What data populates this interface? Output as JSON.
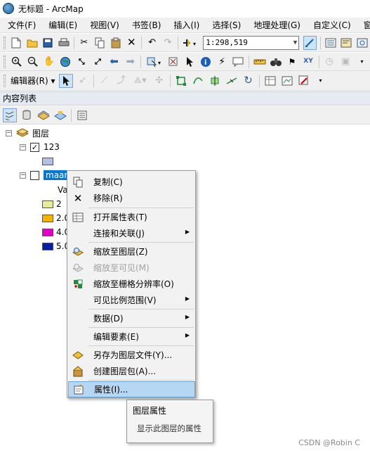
{
  "window": {
    "title": "无标题 - ArcMap"
  },
  "menubar": [
    "文件(F)",
    "编辑(E)",
    "视图(V)",
    "书签(B)",
    "插入(I)",
    "选择(S)",
    "地理处理(G)",
    "自定义(C)",
    "窗口("
  ],
  "toolbar": {
    "scale_value": "1:298,519",
    "editor_label": "编辑器(R)"
  },
  "toc": {
    "title": "内容列表",
    "root_label": "图层",
    "layer1_name": "123",
    "layer2_name_visible": "maan",
    "value_header": "Va",
    "legend": [
      {
        "label": "2",
        "color": "#e8ec9a"
      },
      {
        "label": "2.0",
        "color": "#f2b400"
      },
      {
        "label": "4.0",
        "color": "#e000c8"
      },
      {
        "label": "5.0",
        "color": "#0a1ea0"
      }
    ]
  },
  "context_menu": {
    "items": [
      {
        "label": "复制(C)",
        "icon": "copy-icon"
      },
      {
        "label": "移除(R)",
        "icon": "remove-icon"
      },
      {
        "label": "打开属性表(T)",
        "icon": "table-icon"
      },
      {
        "label": "连接和关联(J)",
        "icon": ""
      },
      {
        "label": "缩放至图层(Z)",
        "icon": "zoom-to-layer-icon"
      },
      {
        "label": "缩放至可见(M)",
        "icon": "zoom-to-visible-icon"
      },
      {
        "label": "缩放至栅格分辨率(O)",
        "icon": "zoom-raster-icon"
      },
      {
        "label": "可见比例范围(V)",
        "icon": ""
      },
      {
        "label": "数据(D)",
        "icon": ""
      },
      {
        "label": "编辑要素(E)",
        "icon": ""
      },
      {
        "label": "另存为图层文件(Y)...",
        "icon": "save-layer-icon"
      },
      {
        "label": "创建图层包(A)...",
        "icon": "layer-package-icon"
      },
      {
        "label": "属性(I)...",
        "icon": "properties-icon"
      }
    ]
  },
  "tooltip": {
    "title": "图层属性",
    "description": "显示此图层的属性"
  },
  "watermark": "CSDN @Robin C"
}
